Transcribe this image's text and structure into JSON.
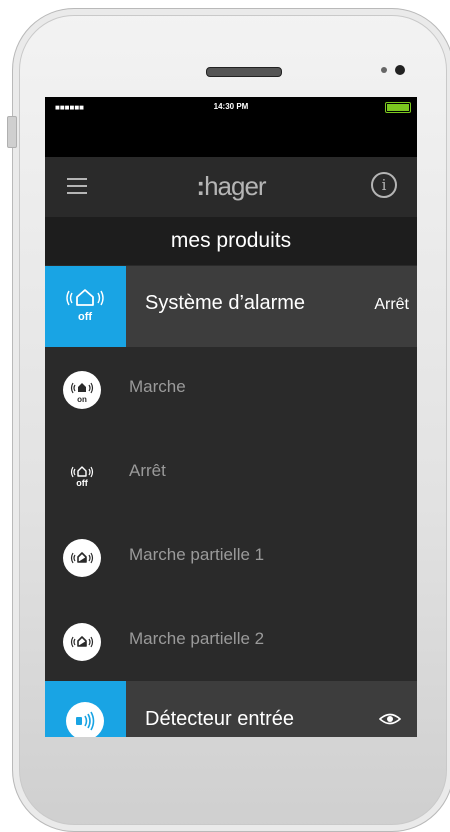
{
  "statusbar": {
    "signal": "■■■■■■",
    "time": "14:30 PM",
    "battery_level": 1.0
  },
  "navbar": {
    "logo_colon": ":",
    "logo_text": "hager"
  },
  "page": {
    "title": "mes produits"
  },
  "system": {
    "label": "Système d’alarme",
    "status": "Arrêt",
    "tile_badge": "off",
    "accent_color": "#19a4e4"
  },
  "modes": [
    {
      "label": "Marche",
      "badge": "on",
      "icon": "alarm-on-icon"
    },
    {
      "label": "Arrêt",
      "badge": "off",
      "icon": "alarm-off-icon"
    },
    {
      "label": "Marche partielle 1",
      "badge": "",
      "icon": "alarm-partial-icon"
    },
    {
      "label": "Marche partielle 2",
      "badge": "",
      "icon": "alarm-partial-icon"
    }
  ],
  "detector": {
    "label": "Détecteur entrée",
    "icon": "detector-icon",
    "action_icon": "eye-icon"
  },
  "icons": {
    "menu": "menu-icon",
    "info": "info-icon",
    "info_glyph": "i"
  }
}
